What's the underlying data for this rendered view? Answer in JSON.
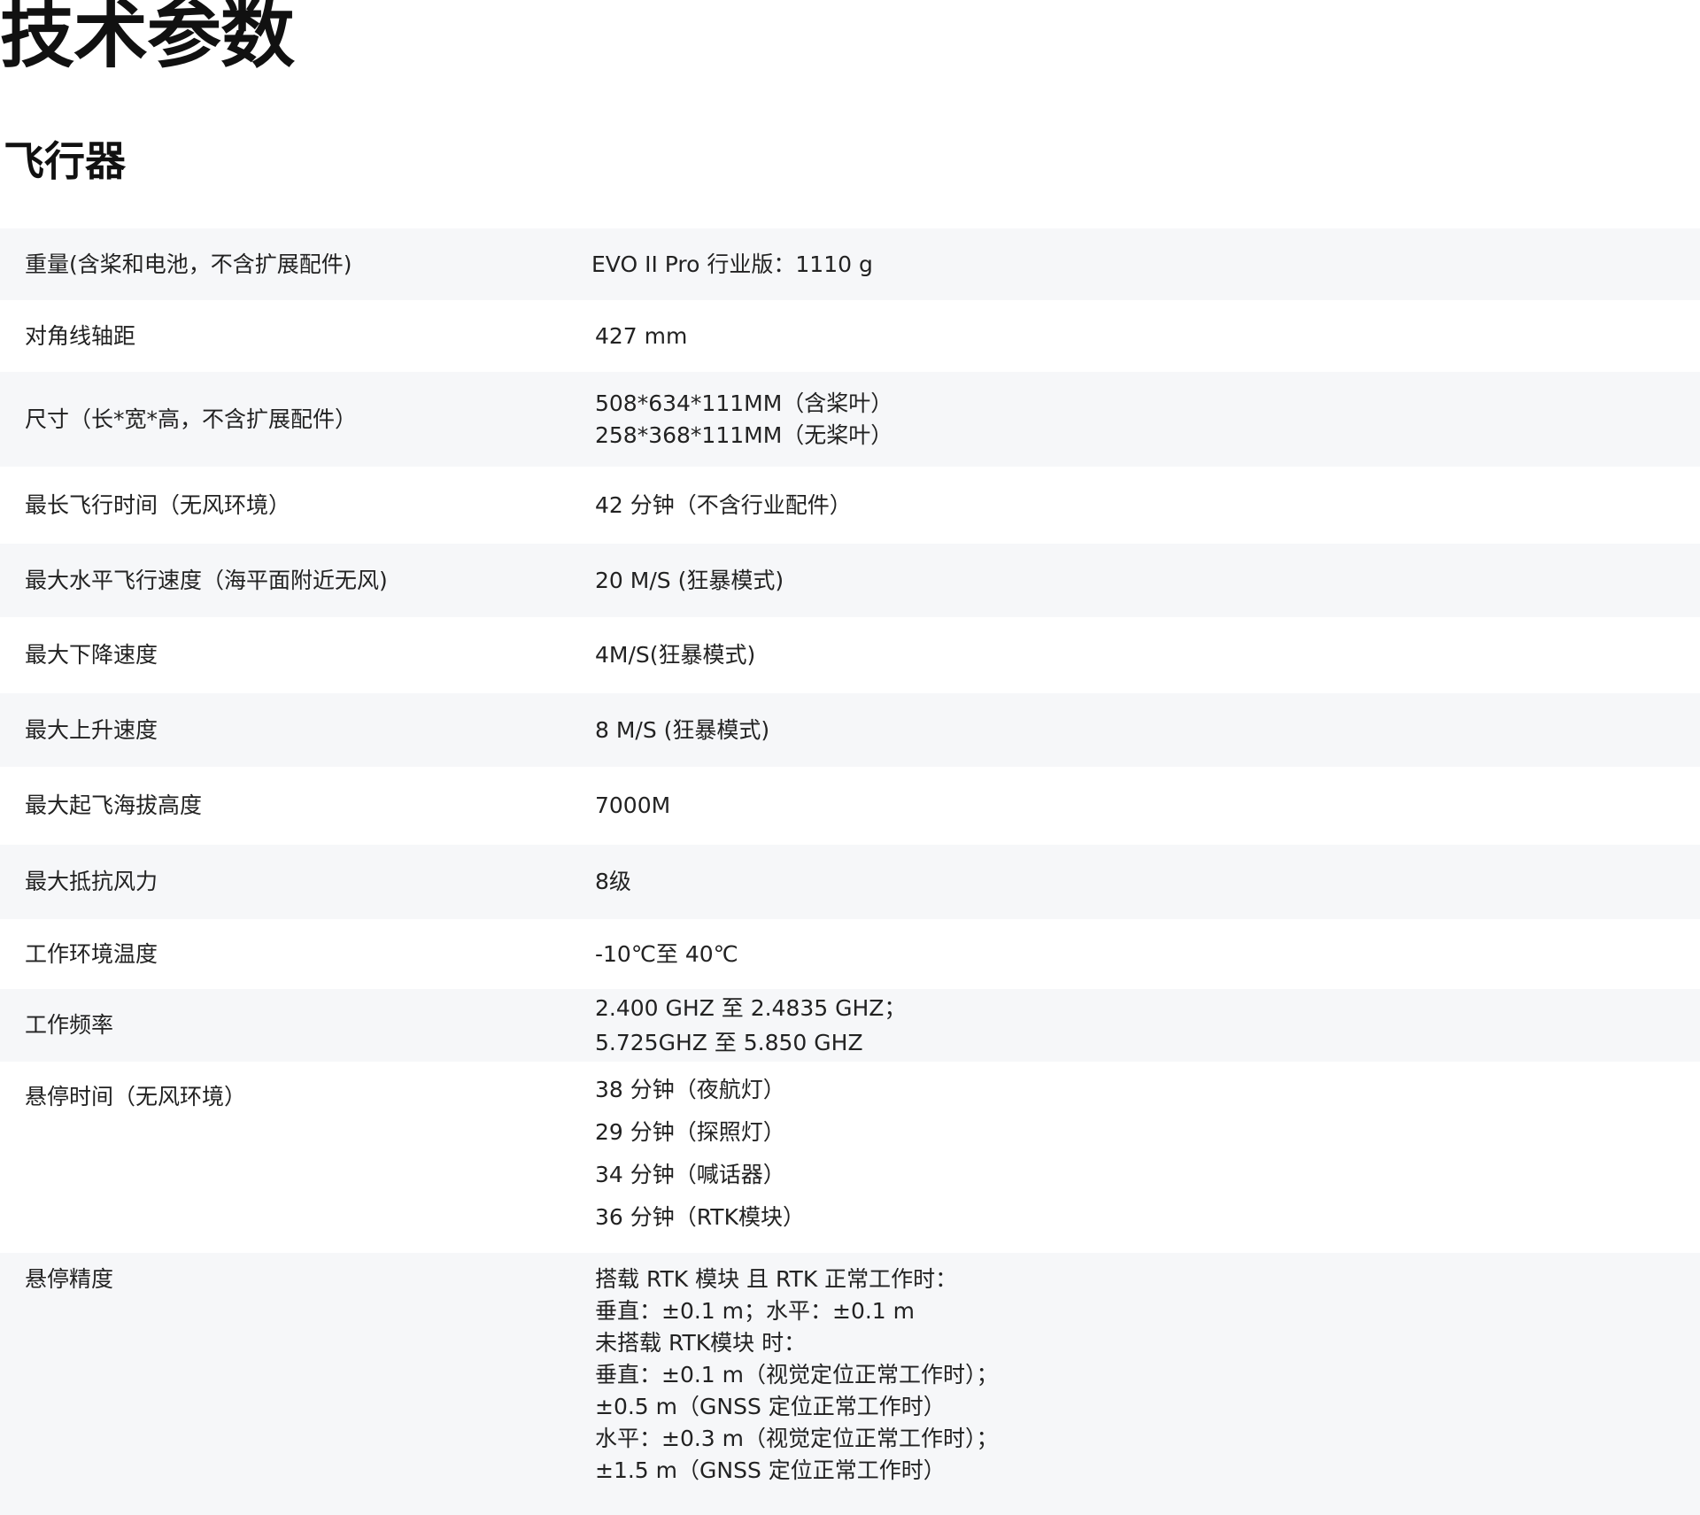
{
  "page": {
    "title": "技术参数",
    "section_title": "飞行器"
  },
  "specs": [
    {
      "label": "重量(含桨和电池，不含扩展配件)",
      "values": [
        "EVO II Pro 行业版：1110 g"
      ]
    },
    {
      "label": "对角线轴距",
      "values": [
        "427 mm"
      ]
    },
    {
      "label": "尺寸（长*宽*高，不含扩展配件）",
      "values": [
        "508*634*111MM（含桨叶）",
        "258*368*111MM（无桨叶）"
      ]
    },
    {
      "label": "最长飞行时间（无风环境）",
      "values": [
        "42 分钟（不含行业配件）"
      ]
    },
    {
      "label": "最大水平飞行速度（海平面附近无风)",
      "values": [
        "20 M/S (狂暴模式)"
      ]
    },
    {
      "label": "最大下降速度",
      "values": [
        "4M/S(狂暴模式)"
      ]
    },
    {
      "label": "最大上升速度",
      "values": [
        "8 M/S (狂暴模式)"
      ]
    },
    {
      "label": "最大起飞海拔高度",
      "values": [
        "7000M"
      ]
    },
    {
      "label": "最大抵抗风力",
      "values": [
        "8级"
      ]
    },
    {
      "label": "工作环境温度",
      "values": [
        "-10℃至 40℃"
      ]
    },
    {
      "label": "工作频率",
      "values": [
        "2.400 GHZ 至 2.4835 GHZ；",
        "5.725GHZ 至 5.850 GHZ"
      ]
    },
    {
      "label": "悬停时间（无风环境）",
      "values": [
        "38 分钟（夜航灯）",
        "29 分钟（探照灯）",
        "34 分钟（喊话器）",
        "36 分钟（RTK模块）"
      ]
    },
    {
      "label": "悬停精度",
      "values": [
        "搭载 RTK 模块 且 RTK 正常工作时：",
        "垂直：±0.1 m；水平：±0.1 m",
        "未搭载 RTK模块 时：",
        "垂直：±0.1 m（视觉定位正常工作时）；",
        "±0.5 m（GNSS 定位正常工作时）",
        "水平：±0.3 m（视觉定位正常工作时）；",
        "±1.5 m（GNSS 定位正常工作时）"
      ]
    }
  ]
}
